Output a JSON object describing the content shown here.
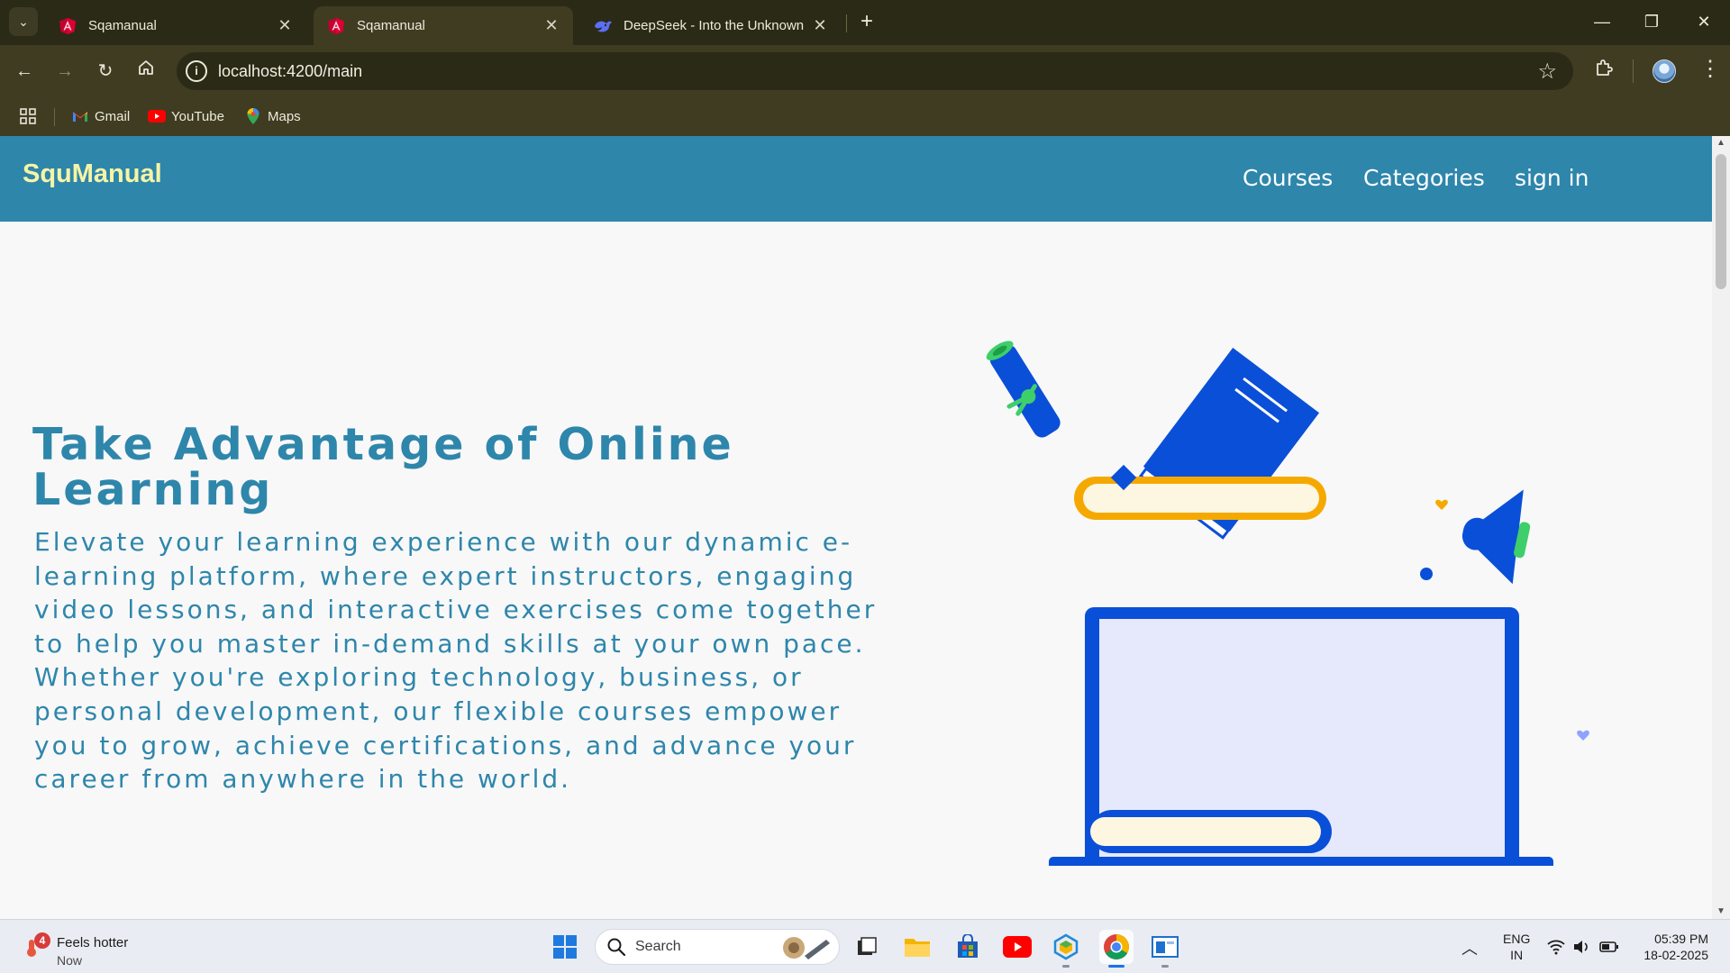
{
  "browser": {
    "tabs": [
      {
        "title": "Sqamanual",
        "active": false
      },
      {
        "title": "Sqamanual",
        "active": true
      },
      {
        "title": "DeepSeek - Into the Unknown",
        "active": false
      }
    ],
    "url": "localhost:4200/main",
    "bookmarks": [
      {
        "label": "Gmail",
        "icon": "gmail-icon"
      },
      {
        "label": "YouTube",
        "icon": "youtube-icon"
      },
      {
        "label": "Maps",
        "icon": "maps-icon"
      }
    ]
  },
  "site": {
    "brand": "SquManual",
    "nav": [
      {
        "label": "Courses"
      },
      {
        "label": "Categories"
      },
      {
        "label": "sign in"
      }
    ],
    "hero": {
      "title": "Take Advantage of Online Learning",
      "text": "Elevate your learning experience with our dynamic e-learning platform, where expert instructors, engaging video lessons, and interactive exercises come together to help you master in-demand skills at your own pace. Whether you're exploring technology, business, or personal development, our flexible courses empower you to grow, achieve certifications, and advance your career from anywhere in the world."
    },
    "colors": {
      "nav_bg": "#2e86ab",
      "brand": "#f6f4a6",
      "accent_blue": "#0a4fd8",
      "accent_yellow": "#f5a900"
    }
  },
  "taskbar": {
    "weather": {
      "badge": "4",
      "line1": "Feels hotter",
      "line2": "Now"
    },
    "search_placeholder": "Search",
    "lang": {
      "line1": "ENG",
      "line2": "IN"
    },
    "clock": {
      "time": "05:39 PM",
      "date": "18-02-2025"
    }
  }
}
